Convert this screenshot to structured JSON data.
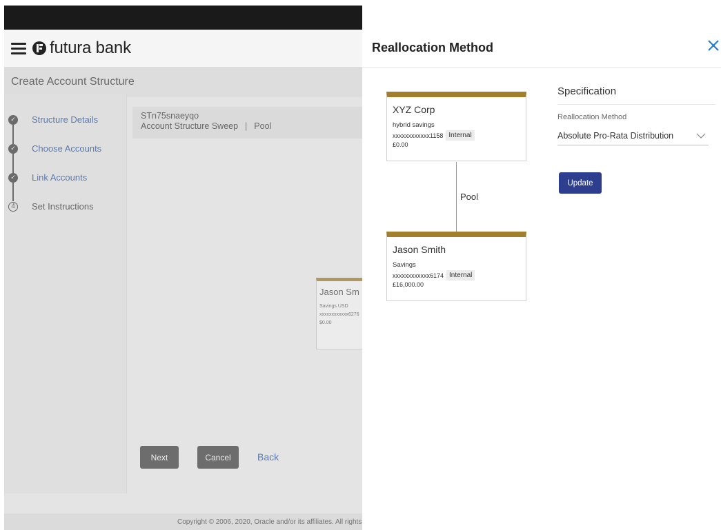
{
  "background": {
    "brand": "futura bank",
    "page_title": "Create Account Structure",
    "steps": [
      {
        "label": "Structure Details",
        "state": "done"
      },
      {
        "label": "Choose Accounts",
        "state": "done"
      },
      {
        "label": "Link Accounts",
        "state": "done"
      },
      {
        "label": "Set Instructions",
        "state": "current",
        "number": "4"
      }
    ],
    "structure_code": "STn75snaeyqo",
    "structure_type": "Account Structure Sweep",
    "structure_sep": "|",
    "structure_variant": "Pool",
    "partial_card": {
      "name": "Jason Sm",
      "line1": "Savings USD",
      "line2": "xxxxxxxxxxxx6276",
      "line3": "$0.00"
    },
    "buttons": {
      "next": "Next",
      "cancel": "Cancel",
      "back": "Back"
    },
    "footer": "Copyright © 2006, 2020, Oracle and/or its affiliates. All rights"
  },
  "panel": {
    "title": "Reallocation Method",
    "close_icon": "close-icon",
    "parent_card": {
      "name": "XYZ Corp",
      "account_type": "hybrid savings",
      "account_number": "xxxxxxxxxxxx1158",
      "badge": "Internal",
      "balance": "£0.00"
    },
    "link_label": "Pool",
    "child_card": {
      "name": "Jason Smith",
      "account_type": "Savings",
      "account_number": "xxxxxxxxxxxx6174",
      "badge": "Internal",
      "balance": "£16,000.00"
    },
    "specification": {
      "heading": "Specification",
      "field_label": "Reallocation Method",
      "selected_value": "Absolute Pro-Rata Distribution"
    },
    "update_label": "Update"
  },
  "colors": {
    "accent_gold": "#a17f2c",
    "primary_blue": "#2e3e8f",
    "link_blue": "#1f4fa0",
    "close_blue": "#1f78d1"
  }
}
